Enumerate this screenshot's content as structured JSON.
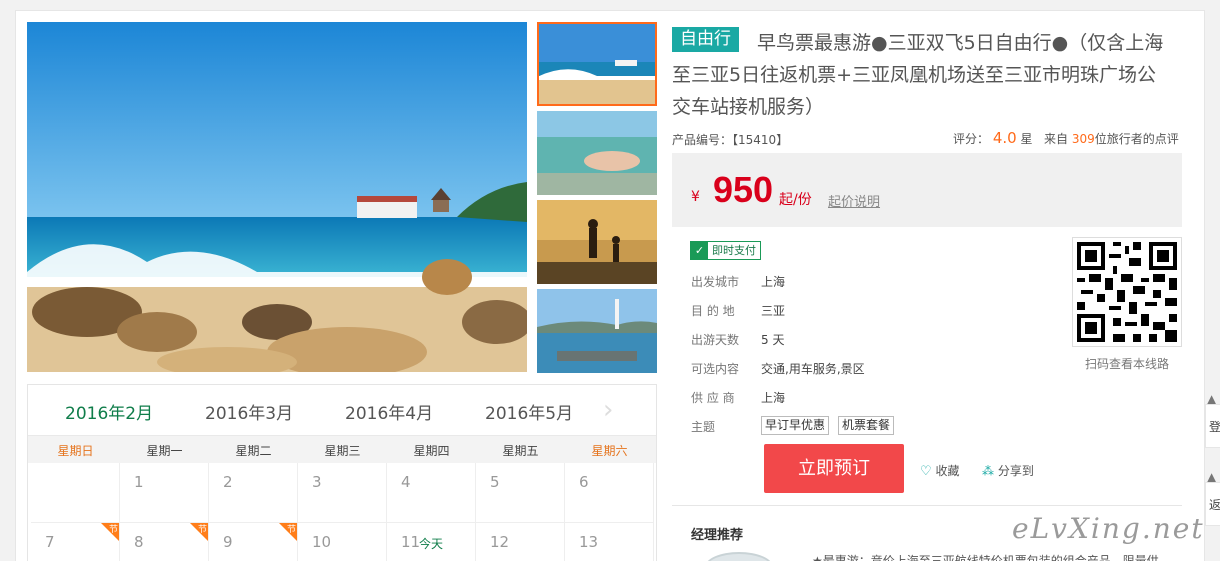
{
  "title": {
    "badge": "自由行",
    "line1": "早鸟票最惠游●三亚双飞5日自由行●（仅含上海",
    "line2": "至三亚5日往返机票+三亚凤凰机场送至三亚市明珠广场公",
    "line3": "交车站接机服务）"
  },
  "meta": {
    "product_code_label": "产品编号：",
    "product_code": "【15410】",
    "score_label": "评分：",
    "score": "4.0",
    "score_unit": "星",
    "from_label": "来自",
    "reviewer_count": "309",
    "reviewer_suffix": "位旅行者的点评"
  },
  "price": {
    "currency": "¥",
    "amount": "950",
    "unit": "起/份",
    "note_link": "起价说明"
  },
  "pay_badge": "即时支付",
  "info": [
    {
      "label": "出发城市",
      "value": "上海"
    },
    {
      "label": "目 的 地",
      "value": "三亚"
    },
    {
      "label": "出游天数",
      "value": "5 天"
    },
    {
      "label": "可选内容",
      "value": "交通,用车服务,景区"
    },
    {
      "label": "供 应 商",
      "value": "上海"
    },
    {
      "label": "主题",
      "value": ""
    }
  ],
  "themes": [
    "早订早优惠",
    "机票套餐"
  ],
  "qr_caption": "扫码查看本线路",
  "actions": {
    "book": "立即预订",
    "favorite": "收藏",
    "share": "分享到"
  },
  "recommend": {
    "title": "经理推荐",
    "text": "★最惠游：竞价上海至三亚航线特价机票包装的组合产品，限量供"
  },
  "calendar": {
    "months": [
      "2016年2月",
      "2016年3月",
      "2016年4月",
      "2016年5月"
    ],
    "active_month": "2016年2月",
    "weekdays": [
      "星期日",
      "星期一",
      "星期二",
      "星期三",
      "星期四",
      "星期五",
      "星期六"
    ],
    "row1": [
      "",
      "1",
      "2",
      "3",
      "4",
      "5",
      "6"
    ],
    "row2": [
      "7",
      "8",
      "9",
      "10",
      "11",
      "12",
      "13"
    ],
    "today_label": "今天",
    "holiday_tag": "节"
  },
  "watermark": "eLvXing.net",
  "side_tabs": [
    "登",
    "返"
  ],
  "colors": {
    "accent_teal": "#1aa9a4",
    "price_red": "#d9001b",
    "book_button": "#f2484a",
    "holiday_orange": "#ff7e1a",
    "active_green": "#0f7d4a"
  }
}
